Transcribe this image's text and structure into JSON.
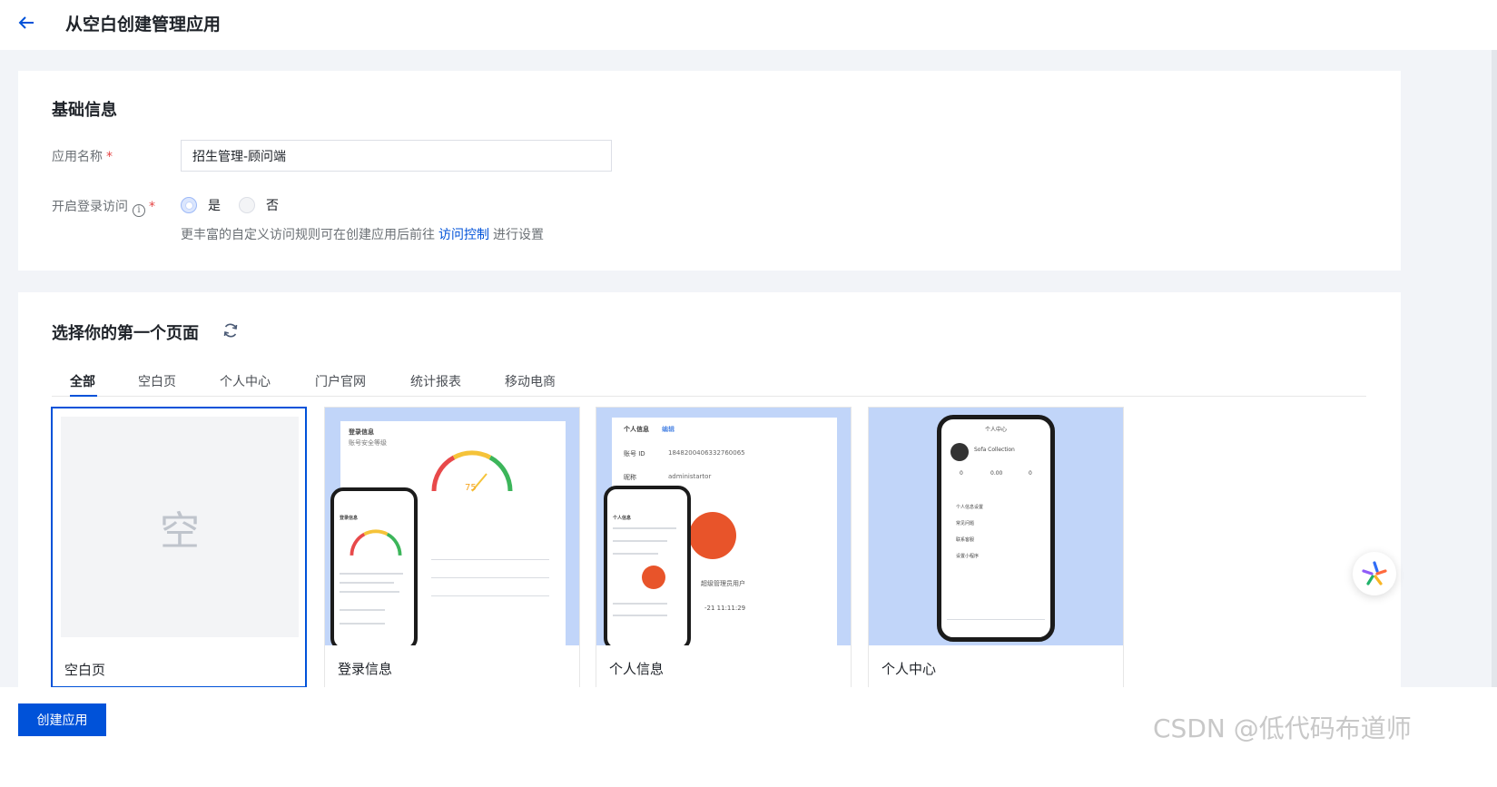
{
  "header": {
    "title": "从空白创建管理应用"
  },
  "basic_info": {
    "section_title": "基础信息",
    "app_name_label": "应用名称",
    "app_name_value": "招生管理-顾问端",
    "login_access_label": "开启登录访问",
    "required_mark": "*",
    "info_icon_glyph": "i",
    "options": [
      "是",
      "否"
    ],
    "selected_option": "是",
    "hint_prefix": "更丰富的自定义访问规则可在创建应用后前往",
    "hint_link": "访问控制",
    "hint_suffix": "进行设置"
  },
  "page_select": {
    "section_title": "选择你的第一个页面",
    "tabs": [
      "全部",
      "空白页",
      "个人中心",
      "门户官网",
      "统计报表",
      "移动电商"
    ],
    "active_tab": "全部",
    "templates": [
      {
        "name": "空白页",
        "preview_char": "空",
        "selected": true
      },
      {
        "name": "登录信息",
        "selected": false
      },
      {
        "name": "个人信息",
        "selected": false
      },
      {
        "name": "个人中心",
        "selected": false
      }
    ],
    "mock": {
      "login_title": "登录信息",
      "login_sub": "账号安全等级",
      "gauge_value": "75",
      "personal_title": "个人信息",
      "personal_edit": "编辑",
      "account_id_label": "账号 ID",
      "account_id_value": "1848200406332760065",
      "nickname_label": "昵称",
      "nickname_value": "administartor",
      "user_fragment": "超级管理员用户",
      "time_fragment": "-21 11:11:29",
      "center_title": "个人中心",
      "center_user": "Sofa Collection",
      "center_stats": [
        "0",
        "0.00",
        "0"
      ],
      "center_menu": [
        "个人信息设置",
        "常见问题",
        "联系客服",
        "设置小程序"
      ]
    }
  },
  "footer": {
    "create_button": "创建应用",
    "watermark": "CSDN @低代码布道师"
  },
  "colors": {
    "primary": "#0052d9",
    "preview_bg": "#c1d5f9",
    "required": "#e54545"
  },
  "icons": {
    "back": "arrow-left-icon",
    "refresh": "refresh-icon",
    "info": "info-circle-icon",
    "assistant": "assistant-logo-icon"
  }
}
